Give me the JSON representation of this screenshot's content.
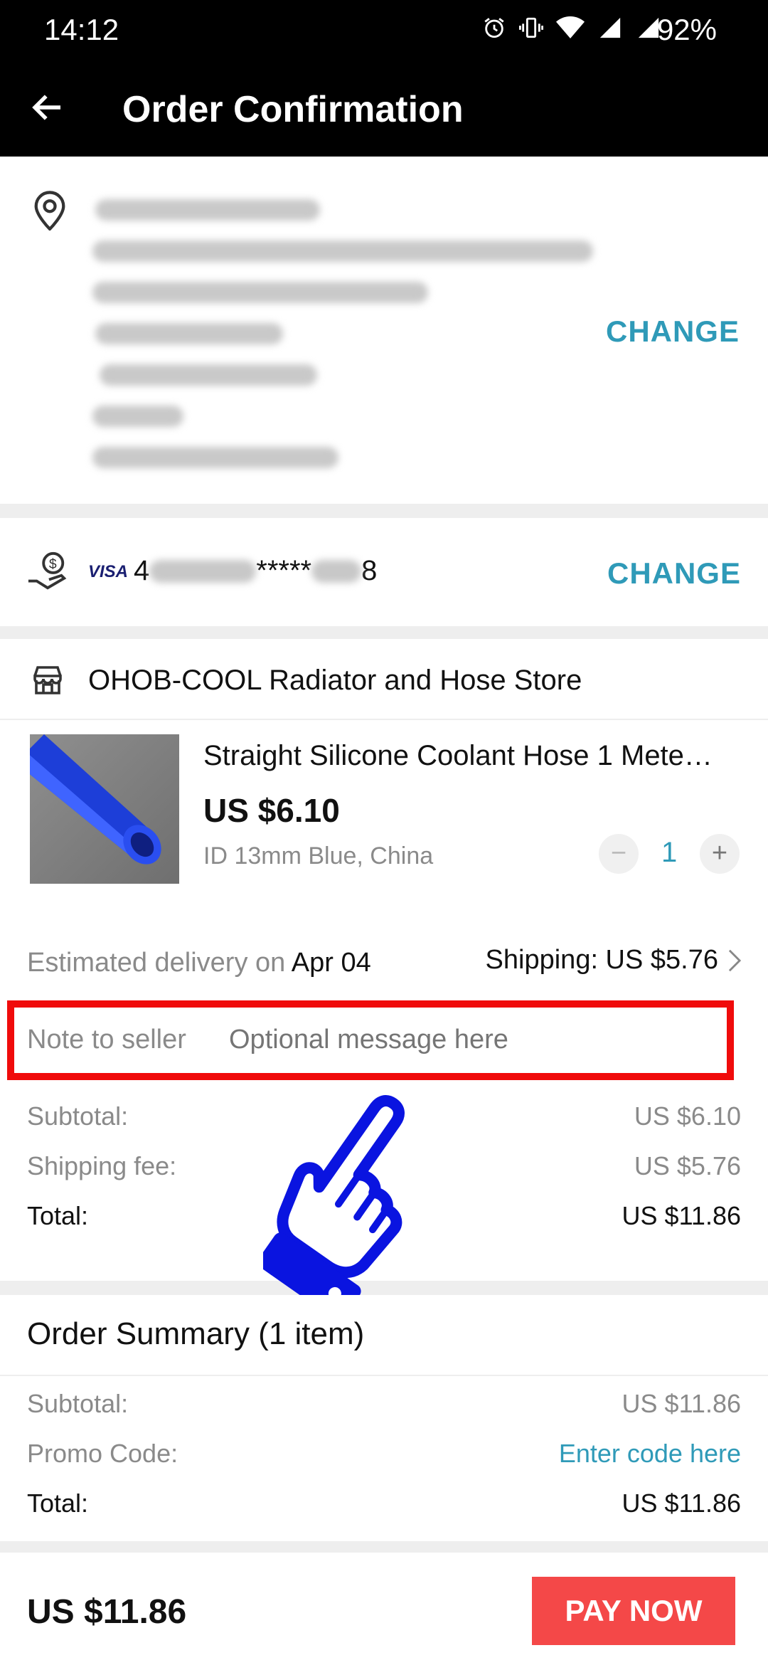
{
  "status_bar": {
    "time": "14:12",
    "battery": "92%",
    "icons": [
      "alarm-icon",
      "vibrate-icon",
      "wifi-icon",
      "signal-icon",
      "signal-icon"
    ]
  },
  "app_bar": {
    "title": "Order Confirmation"
  },
  "address": {
    "change_label": "CHANGE"
  },
  "payment": {
    "card_brand": "VISA",
    "card_first": "4",
    "card_mid": "*****",
    "card_last": "8",
    "change_label": "CHANGE"
  },
  "store": {
    "name": "OHOB-COOL Radiator and Hose Store"
  },
  "product": {
    "title": "Straight Silicone Coolant Hose 1 Mete…",
    "price": "US $6.10",
    "variant": "ID 13mm Blue, China",
    "quantity": "1",
    "minus_label": "−",
    "plus_label": "+"
  },
  "delivery": {
    "estimated_prefix": "Estimated delivery on",
    "date": "Apr 04",
    "shipping_label": "Shipping: US $5.76"
  },
  "note": {
    "label": "Note to seller",
    "placeholder": "Optional message here"
  },
  "store_totals": {
    "subtotal_label": "Subtotal:",
    "subtotal_value": "US $6.10",
    "shipping_label": "Shipping fee:",
    "shipping_value": "US $5.76",
    "total_label": "Total:",
    "total_value": "US $11.86"
  },
  "order_summary": {
    "title": "Order Summary (1 item)",
    "subtotal_label": "Subtotal:",
    "subtotal_value": "US $11.86",
    "promo_label": "Promo Code:",
    "promo_value": "Enter code here",
    "total_label": "Total:",
    "total_value": "US $11.86"
  },
  "footer": {
    "total": "US $11.86",
    "pay_label": "PAY NOW"
  },
  "colors": {
    "accent": "#2f9ab8",
    "pay": "#f44848",
    "highlight": "#f00b0b",
    "hand": "#0a14e0"
  }
}
